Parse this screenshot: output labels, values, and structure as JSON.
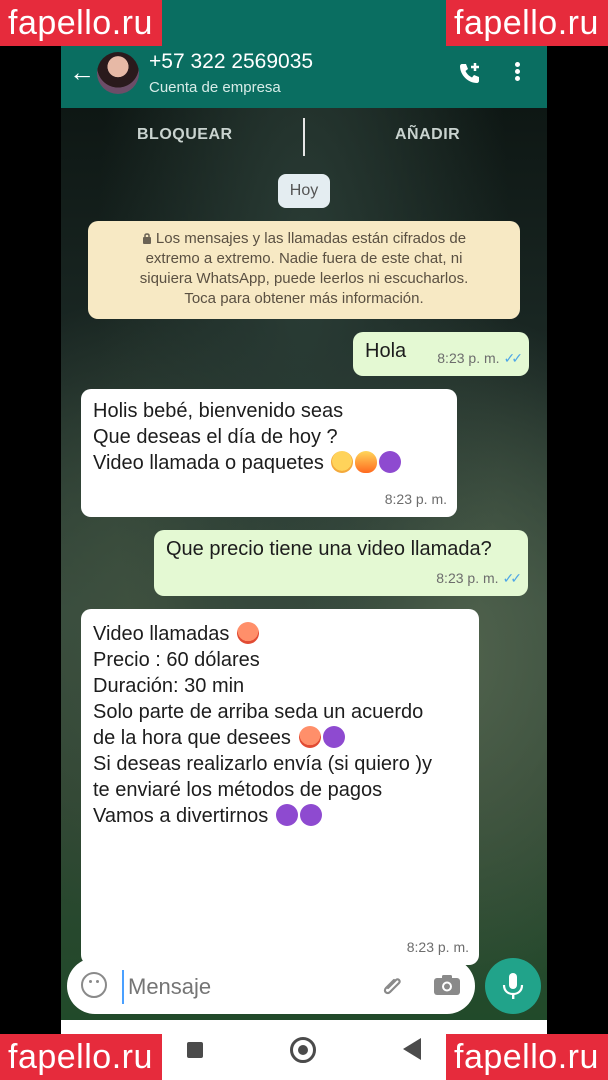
{
  "header": {
    "contact_name": "+57 322 2569035",
    "contact_subtitle": "Cuenta de empresa"
  },
  "actions": {
    "block_label": "BLOQUEAR",
    "add_label": "AÑADIR"
  },
  "day_chip": "Hoy",
  "encryption_notice": {
    "lines": [
      "Los mensajes y las llamadas están cifrados de",
      "extremo a extremo. Nadie fuera de este chat, ni",
      "siquiera WhatsApp, puede leerlos ni escucharlos.",
      "Toca para obtener más información."
    ]
  },
  "messages": [
    {
      "direction": "outgoing",
      "lines": [
        "Hola"
      ],
      "time": "8:23 p. m.",
      "ticks": "✓✓"
    },
    {
      "direction": "incoming",
      "lines": [
        "Holis  bebé,  bienvenido seas",
        "Que deseas el día de hoy ?",
        "Video llamada o paquetes"
      ],
      "time": "8:23 p. m."
    },
    {
      "direction": "outgoing",
      "lines": [
        "Que precio tiene una video llamada?"
      ],
      "time": "8:23 p. m.",
      "ticks": "✓✓"
    },
    {
      "direction": "incoming",
      "lines": [
        "Video llamadas",
        "Precio : 60 dólares",
        "Duración: 30 min",
        "Solo parte de arriba  seda un acuerdo",
        "de la hora que desees",
        "Si deseas realizarlo envía (si quiero )y",
        "te enviaré los métodos de pagos",
        "Vamos a divertirnos"
      ],
      "time": "8:23 p. m."
    }
  ],
  "composer": {
    "placeholder": "Mensaje"
  },
  "watermark": "fapello.ru",
  "colors": {
    "header_bg": "#0a6e61",
    "outgoing_bubble": "#e4f9d3",
    "incoming_bubble": "#ffffff",
    "mic_button": "#21a38a",
    "watermark_bg": "#e62b3c"
  }
}
